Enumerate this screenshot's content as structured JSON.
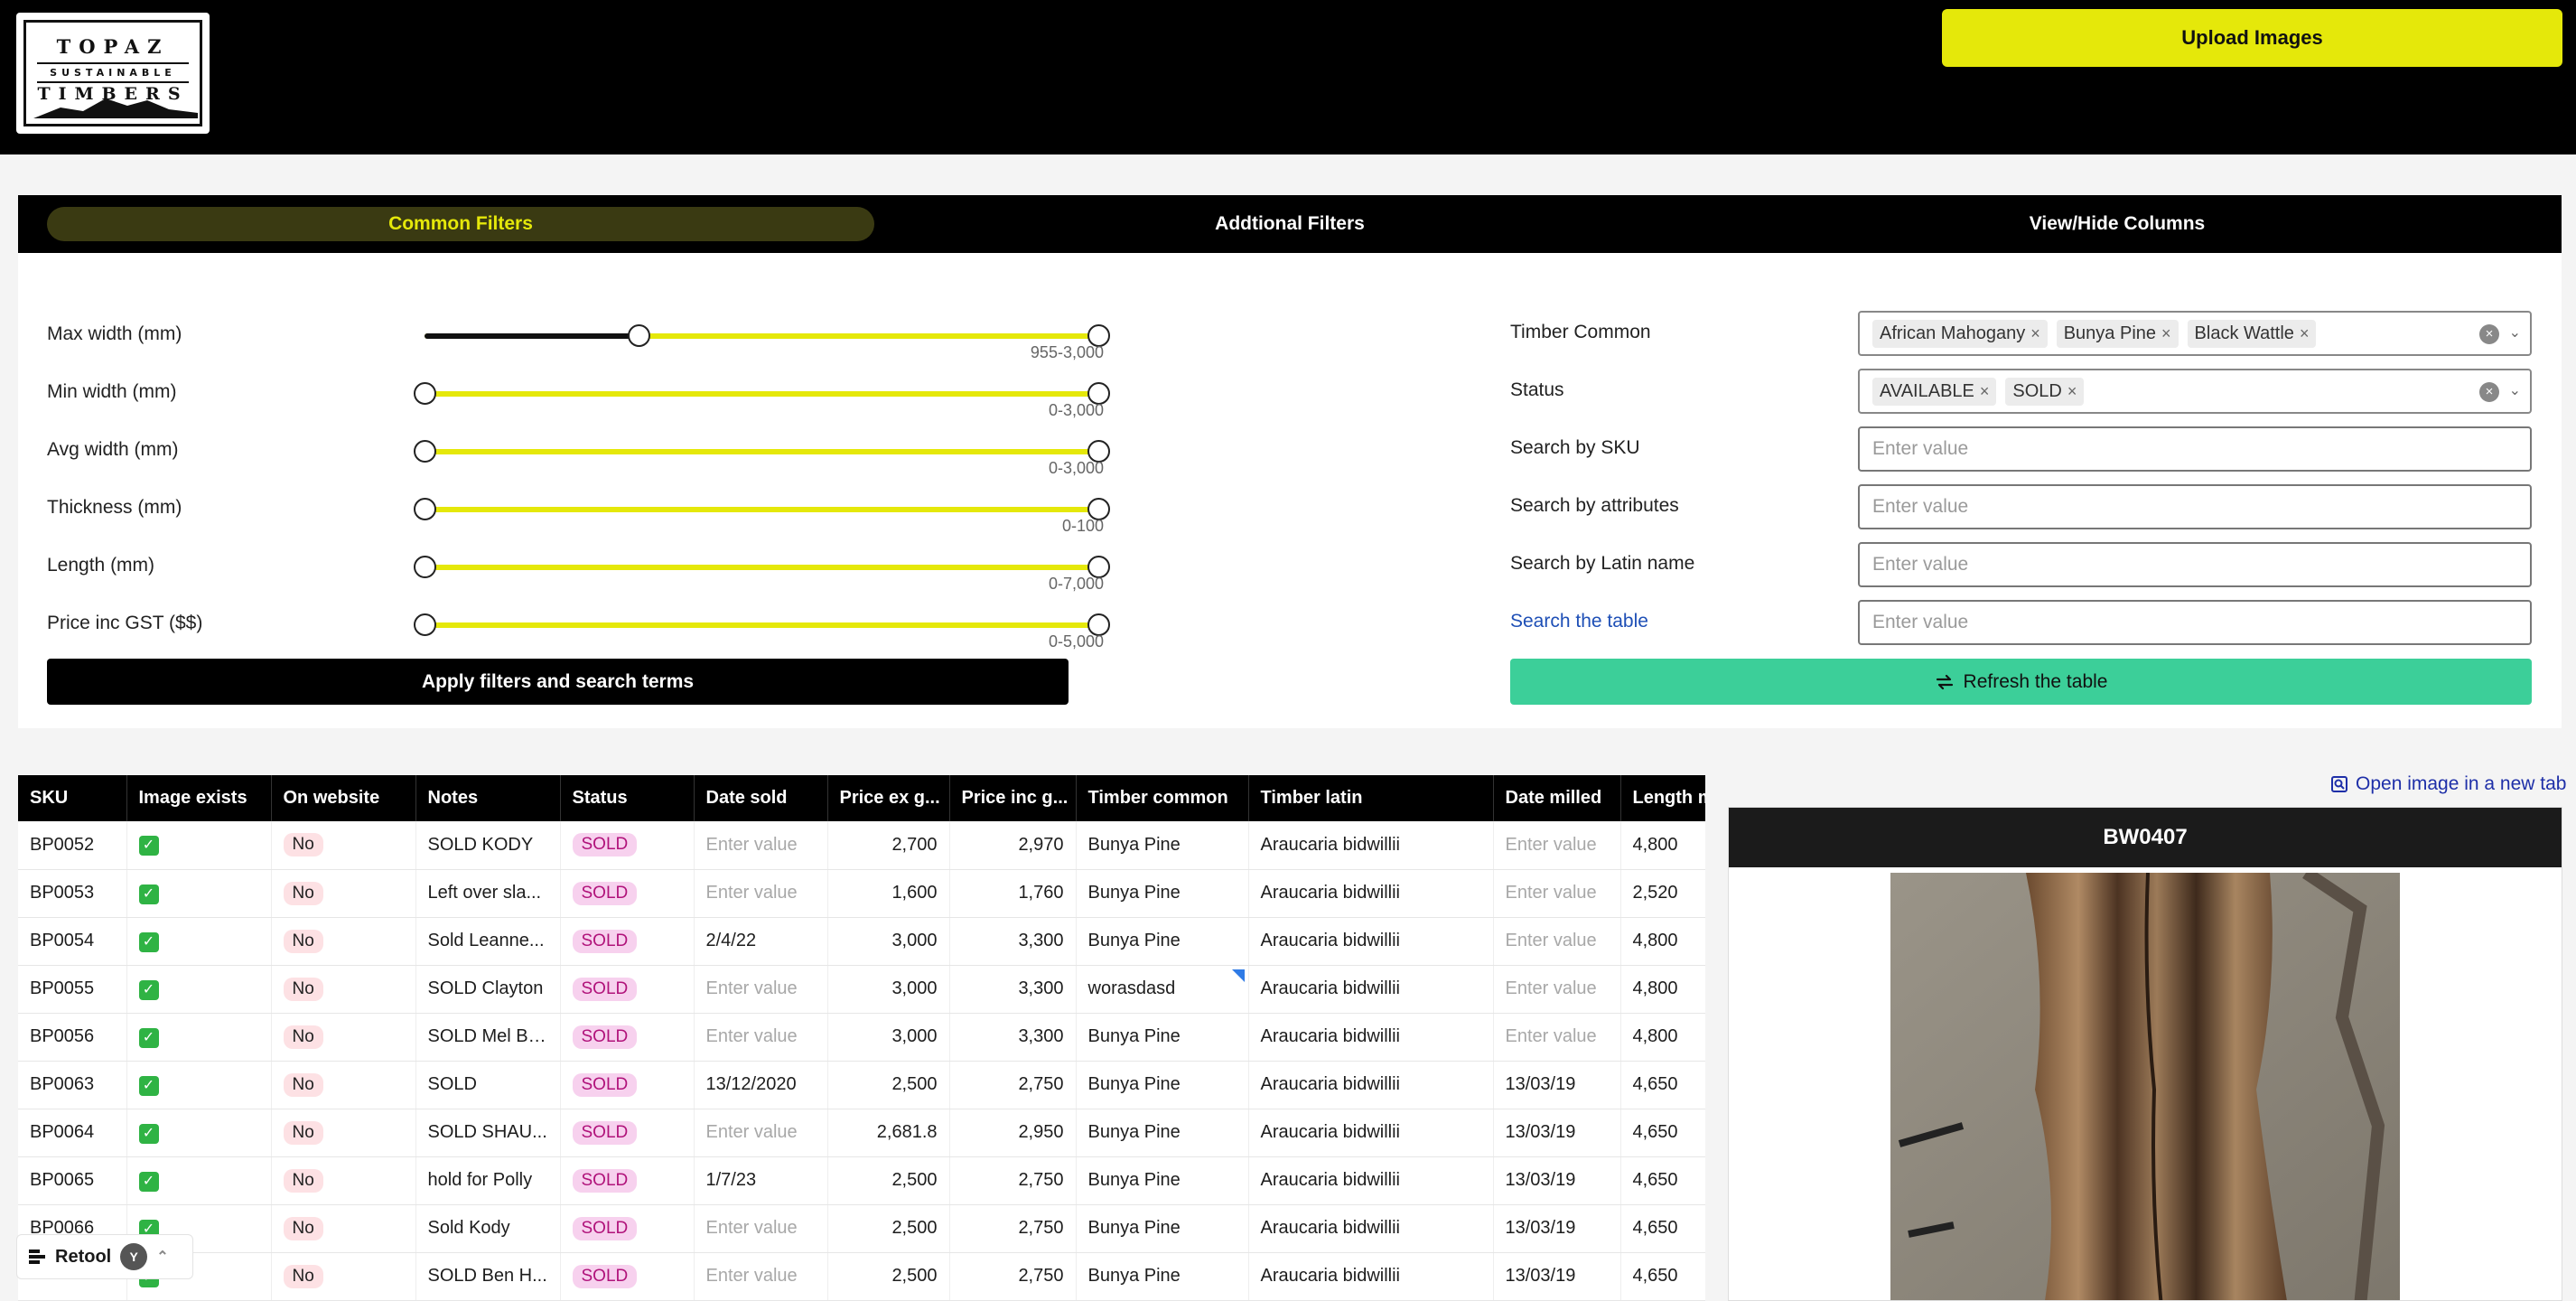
{
  "header": {
    "logo_line1": "TOPAZ",
    "logo_line2": "SUSTAINABLE",
    "logo_line3": "TIMBERS",
    "upload_label": "Upload Images"
  },
  "tabs": [
    {
      "label": "Common Filters",
      "active": true
    },
    {
      "label": "Addtional Filters",
      "active": false
    },
    {
      "label": "View/Hide Columns",
      "active": false
    }
  ],
  "sliders": [
    {
      "label": "Max width (mm)",
      "range": "955-3,000",
      "low_fraction": 0.318,
      "high_fraction": 1.0
    },
    {
      "label": "Min width (mm)",
      "range": "0-3,000",
      "low_fraction": 0.0,
      "high_fraction": 1.0
    },
    {
      "label": "Avg width (mm)",
      "range": "0-3,000",
      "low_fraction": 0.0,
      "high_fraction": 1.0
    },
    {
      "label": "Thickness (mm)",
      "range": "0-100",
      "low_fraction": 0.0,
      "high_fraction": 1.0
    },
    {
      "label": "Length (mm)",
      "range": "0-7,000",
      "low_fraction": 0.0,
      "high_fraction": 1.0
    },
    {
      "label": "Price inc GST ($$)",
      "range": "0-5,000",
      "low_fraction": 0.0,
      "high_fraction": 1.0
    }
  ],
  "apply_label": "Apply filters and search terms",
  "form": {
    "timber_common_label": "Timber Common",
    "timber_common_chips": [
      "African Mahogany",
      "Bunya Pine",
      "Black Wattle"
    ],
    "status_label": "Status",
    "status_chips": [
      "AVAILABLE",
      "SOLD"
    ],
    "sku_label": "Search by SKU",
    "attributes_label": "Search by attributes",
    "latin_label": "Search by Latin name",
    "table_search_label": "Search the table",
    "placeholder": "Enter value",
    "chip_remove": "×",
    "clear_glyph": "×",
    "chevron_glyph": "⌄"
  },
  "refresh_label": "Refresh the table",
  "table": {
    "columns": [
      "SKU",
      "Image exists",
      "On website",
      "Notes",
      "Status",
      "Date sold",
      "Price ex g...",
      "Price inc g...",
      "Timber common",
      "Timber latin",
      "Date milled",
      "Length m"
    ],
    "rows": [
      {
        "sku": "BP0052",
        "image": "✓",
        "web": "No",
        "notes": "SOLD KODY",
        "status": "SOLD",
        "date_sold": "Enter value",
        "price_ex": "2,700",
        "price_inc": "2,970",
        "common": "Bunya Pine",
        "latin": "Araucaria bidwillii",
        "milled": "Enter value",
        "length": "4,800"
      },
      {
        "sku": "BP0053",
        "image": "✓",
        "web": "No",
        "notes": "Left over sla...",
        "status": "SOLD",
        "date_sold": "Enter value",
        "price_ex": "1,600",
        "price_inc": "1,760",
        "common": "Bunya Pine",
        "latin": "Araucaria bidwillii",
        "milled": "Enter value",
        "length": "2,520"
      },
      {
        "sku": "BP0054",
        "image": "✓",
        "web": "No",
        "notes": "Sold Leanne...",
        "status": "SOLD",
        "date_sold": "2/4/22",
        "price_ex": "3,000",
        "price_inc": "3,300",
        "common": "Bunya Pine",
        "latin": "Araucaria bidwillii",
        "milled": "Enter value",
        "length": "4,800"
      },
      {
        "sku": "BP0055",
        "image": "✓",
        "web": "No",
        "notes": "SOLD Clayton",
        "status": "SOLD",
        "date_sold": "Enter value",
        "price_ex": "3,000",
        "price_inc": "3,300",
        "common": "worasdasd",
        "latin": "Araucaria bidwillii",
        "milled": "Enter value",
        "length": "4,800",
        "edited": true
      },
      {
        "sku": "BP0056",
        "image": "✓",
        "web": "No",
        "notes": "SOLD Mel Br...",
        "status": "SOLD",
        "date_sold": "Enter value",
        "price_ex": "3,000",
        "price_inc": "3,300",
        "common": "Bunya Pine",
        "latin": "Araucaria bidwillii",
        "milled": "Enter value",
        "length": "4,800"
      },
      {
        "sku": "BP0063",
        "image": "✓",
        "web": "No",
        "notes": "SOLD",
        "status": "SOLD",
        "date_sold": "13/12/2020",
        "price_ex": "2,500",
        "price_inc": "2,750",
        "common": "Bunya Pine",
        "latin": "Araucaria bidwillii",
        "milled": "13/03/19",
        "length": "4,650"
      },
      {
        "sku": "BP0064",
        "image": "✓",
        "web": "No",
        "notes": "SOLD SHAU...",
        "status": "SOLD",
        "date_sold": "Enter value",
        "price_ex": "2,681.8",
        "price_inc": "2,950",
        "common": "Bunya Pine",
        "latin": "Araucaria bidwillii",
        "milled": "13/03/19",
        "length": "4,650"
      },
      {
        "sku": "BP0065",
        "image": "✓",
        "web": "No",
        "notes": "hold for Polly",
        "status": "SOLD",
        "date_sold": "1/7/23",
        "price_ex": "2,500",
        "price_inc": "2,750",
        "common": "Bunya Pine",
        "latin": "Araucaria bidwillii",
        "milled": "13/03/19",
        "length": "4,650"
      },
      {
        "sku": "BP0066",
        "image": "✓",
        "web": "No",
        "notes": "Sold Kody",
        "status": "SOLD",
        "date_sold": "Enter value",
        "price_ex": "2,500",
        "price_inc": "2,750",
        "common": "Bunya Pine",
        "latin": "Araucaria bidwillii",
        "milled": "13/03/19",
        "length": "4,650"
      },
      {
        "sku": "",
        "image": "✓",
        "web": "No",
        "notes": "SOLD Ben H...",
        "status": "SOLD",
        "date_sold": "Enter value",
        "price_ex": "2,500",
        "price_inc": "2,750",
        "common": "Bunya Pine",
        "latin": "Araucaria bidwillii",
        "milled": "13/03/19",
        "length": "4,650"
      }
    ]
  },
  "preview": {
    "open_link": "Open image in a new tab",
    "title": "BW0407"
  },
  "retool": {
    "label": "Retool",
    "avatar": "Y",
    "caret": "⌃"
  },
  "colors": {
    "accent": "#e5e80a",
    "refresh": "#3ccf99",
    "sold": "#b0127a"
  }
}
